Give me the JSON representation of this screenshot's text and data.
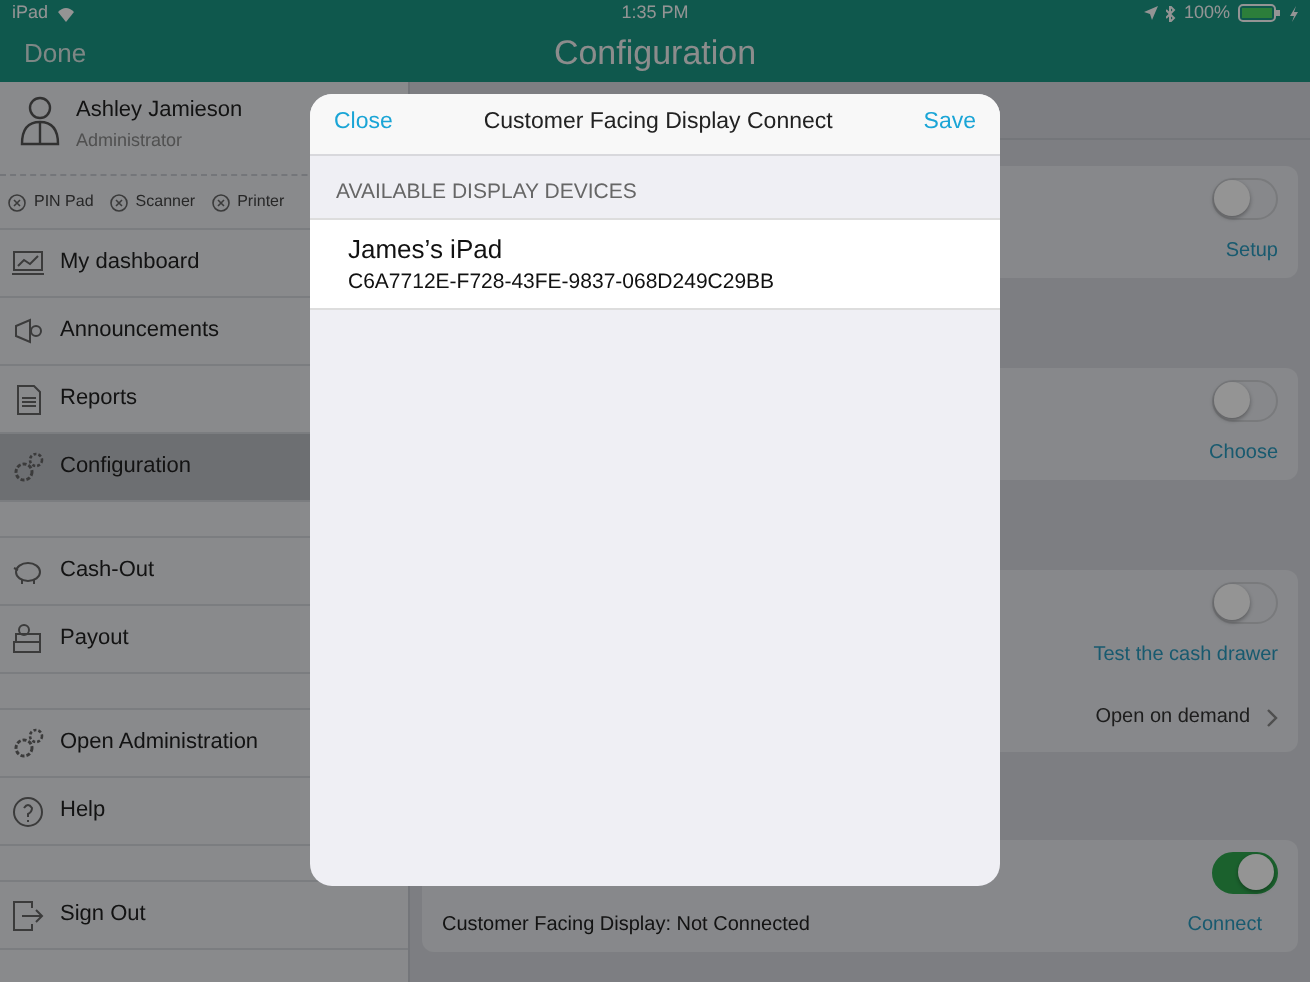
{
  "status_bar": {
    "device": "iPad",
    "time": "1:35 PM",
    "battery": "100%"
  },
  "nav_bar": {
    "left_button": "Done",
    "title": "Configuration"
  },
  "user": {
    "name": "Ashley Jamieson",
    "role": "Administrator"
  },
  "peripherals": [
    {
      "label": "PIN Pad"
    },
    {
      "label": "Scanner"
    },
    {
      "label": "Printer"
    }
  ],
  "sidebar": {
    "sections": [
      {
        "items": [
          {
            "label": "My dashboard",
            "kind": "dashboard",
            "selected": false
          },
          {
            "label": "Announcements",
            "kind": "announce",
            "selected": false
          },
          {
            "label": "Reports",
            "kind": "report",
            "selected": false
          },
          {
            "label": "Configuration",
            "kind": "gears",
            "selected": true
          }
        ]
      },
      {
        "items": [
          {
            "label": "Cash-Out",
            "kind": "piggy",
            "selected": false
          },
          {
            "label": "Payout",
            "kind": "cash",
            "selected": false
          }
        ]
      },
      {
        "items": [
          {
            "label": "Open Administration",
            "kind": "gears",
            "selected": false
          },
          {
            "label": "Help",
            "kind": "help",
            "selected": false
          }
        ]
      },
      {
        "items": [
          {
            "label": "Sign Out",
            "kind": "signout",
            "selected": false
          }
        ]
      }
    ]
  },
  "settings_cards": [
    {
      "on": false,
      "link": "Setup"
    },
    {
      "on": false,
      "link": "Choose"
    },
    {
      "on": false,
      "link": "Test the cash drawer",
      "detail": "Open on demand"
    },
    {
      "on": true,
      "label": "Customer Facing Display: Not Connected",
      "link": "Connect"
    }
  ],
  "dialog": {
    "close": "Close",
    "title": "Customer Facing Display Connect",
    "save": "Save",
    "section_header": "AVAILABLE DISPLAY DEVICES",
    "devices": [
      {
        "name": "James’s iPad",
        "id": "C6A7712E-F728-43FE-9837-068D249C29BB"
      }
    ]
  }
}
